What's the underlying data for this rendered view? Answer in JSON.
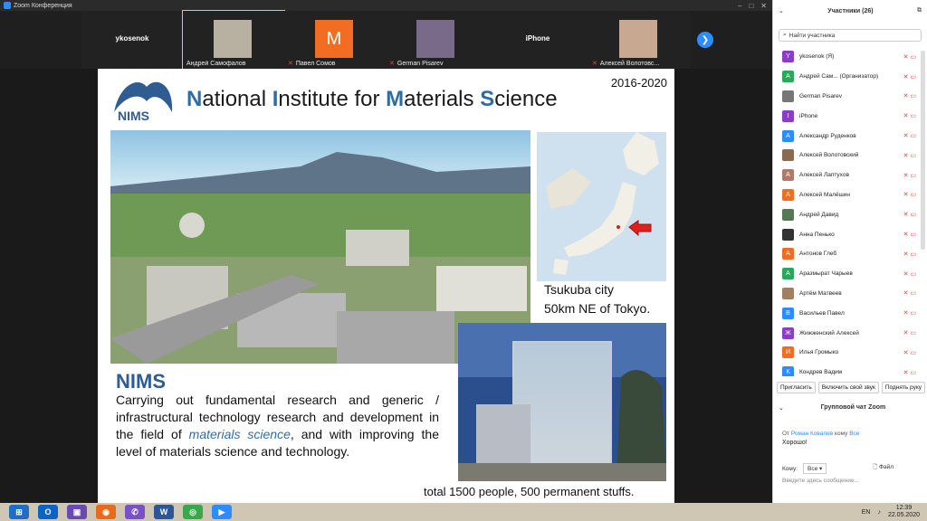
{
  "window": {
    "title": "Zoom Конференция"
  },
  "gallery": {
    "tiles": [
      {
        "center_label": "ykosenok",
        "name": ""
      },
      {
        "center_label": "",
        "name": "Андрей Самофалов"
      },
      {
        "center_label": "",
        "name": "Павел Сомов",
        "avatar_letter": "M"
      },
      {
        "center_label": "",
        "name": "German Pisarev"
      },
      {
        "center_label": "iPhone",
        "name": ""
      },
      {
        "center_label": "",
        "name": "Алексей Волотовс..."
      }
    ],
    "next_icon": "chevron-right-icon"
  },
  "slide": {
    "logo_text": "NIMS",
    "title_parts": [
      {
        "cap": "N",
        "rest": "ational "
      },
      {
        "cap": "I",
        "rest": "nstitute for "
      },
      {
        "cap": "M",
        "rest": "aterials "
      },
      {
        "cap": "S",
        "rest": "cience"
      }
    ],
    "years": "2016-2020",
    "map_caption_1": "Tsukuba city",
    "map_caption_2": "50km NE of Tokyo.",
    "heading": "NIMS",
    "desc_before": "Carrying out fundamental research and generic / infrastructural technology research and development in the field of ",
    "desc_italic": "materials science",
    "desc_after": ", and with improving the level of materials science and technology.",
    "total": "total 1500 people,  500 permanent stuffs."
  },
  "participants": {
    "title": "Участники (26)",
    "search_placeholder": "Найти участника",
    "list": [
      {
        "letter": "Y",
        "color": "#8a3ec8",
        "name": "ykosenok (Я)"
      },
      {
        "letter": "А",
        "color": "#2aa85a",
        "name": "Андрей Сам... (Организатор)"
      },
      {
        "letter": "",
        "color": "#777777",
        "name": "German Pisarev"
      },
      {
        "letter": "I",
        "color": "#8a3ec8",
        "name": "iPhone"
      },
      {
        "letter": "А",
        "color": "#2d8cff",
        "name": "Александр Руденков"
      },
      {
        "letter": "",
        "color": "#8a6a50",
        "name": "Алексей Волотовский"
      },
      {
        "letter": "А",
        "color": "#b07a6a",
        "name": "Алексей Лаптухов"
      },
      {
        "letter": "А",
        "color": "#f26d21",
        "name": "Алексей Малёшин"
      },
      {
        "letter": "",
        "color": "#557755",
        "name": "Андрей Давид"
      },
      {
        "letter": "",
        "color": "#333333",
        "name": "Анна Пенько"
      },
      {
        "letter": "А",
        "color": "#f26d21",
        "name": "Антонов Глеб"
      },
      {
        "letter": "А",
        "color": "#2aa85a",
        "name": "Аразмырат Чарыев"
      },
      {
        "letter": "",
        "color": "#a08060",
        "name": "Артём Матвеев"
      },
      {
        "letter": "В",
        "color": "#2d8cff",
        "name": "Васильев Павел"
      },
      {
        "letter": "Ж",
        "color": "#8a3ec8",
        "name": "Жижженский Алексей"
      },
      {
        "letter": "И",
        "color": "#f26d21",
        "name": "Илья Громыко"
      },
      {
        "letter": "К",
        "color": "#2d8cff",
        "name": "Кондрев Вадим"
      }
    ],
    "buttons": [
      "Пригласить",
      "Включить свой звук",
      "Поднять руку"
    ]
  },
  "chat": {
    "title": "Групповой чат Zoom",
    "from_prefix": "От ",
    "from_name": "Роман Ковалев",
    "to_word": " кому ",
    "to_name": "Все",
    "message": "Хорошо!",
    "to_label": "Кому:",
    "to_value": "Все",
    "file_label": "Файл",
    "input_placeholder": "Введите здесь сообщение..."
  },
  "taskbar": {
    "lang": "EN",
    "time": "12:39",
    "date": "22.05.2020"
  }
}
